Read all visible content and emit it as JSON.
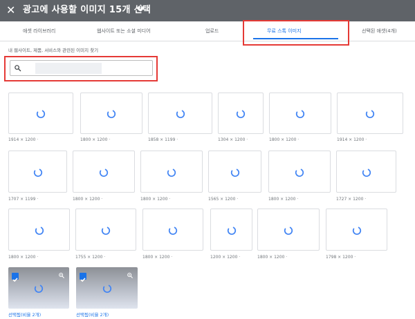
{
  "dialog": {
    "close_label": "✕",
    "title": "광고에 사용할 이미지 15개 선택",
    "help_label": "?"
  },
  "tabs": [
    {
      "label": "애셋 라이브러리"
    },
    {
      "label": "웹사이트 또는 소셜 미디어"
    },
    {
      "label": "업로드"
    },
    {
      "label": "무료 스톡 이미지",
      "active": true
    },
    {
      "label": "선택된 애셋(4개)"
    }
  ],
  "search": {
    "prompt": "내 웹사이트, 제품, 서비스와 관련된 이미지 찾기",
    "value": ""
  },
  "images": [
    {
      "caption": "1914 × 1200 ·"
    },
    {
      "caption": "1800 × 1200 ·"
    },
    {
      "caption": "1858 × 1199 ·"
    },
    {
      "caption": "1304 × 1200 ·"
    },
    {
      "caption": "1800 × 1200 ·"
    },
    {
      "caption": "1914 × 1200 ·"
    },
    {
      "caption": "1707 × 1199 ·"
    },
    {
      "caption": "1800 × 1200 ·"
    },
    {
      "caption": "1800 × 1200 ·"
    },
    {
      "caption": "1565 × 1200 ·"
    },
    {
      "caption": "1800 × 1200 ·"
    },
    {
      "caption": "1727 × 1200 ·"
    },
    {
      "caption": "1800 × 1200 ·"
    },
    {
      "caption": "1755 × 1200 ·"
    },
    {
      "caption": "1800 × 1200 ·"
    },
    {
      "caption": "1200 × 1200 ·"
    },
    {
      "caption": "1800 × 1200 ·"
    },
    {
      "caption": "1798 × 1200 ·"
    }
  ],
  "selected_images": [
    {
      "caption": "선택됨(비율 2개)",
      "checked": true
    },
    {
      "caption": "선택됨(비율 2개)",
      "checked": true
    }
  ],
  "colors": {
    "title_bar": "#5f6368",
    "accent": "#1a73e8",
    "highlight_box": "#e53935"
  }
}
